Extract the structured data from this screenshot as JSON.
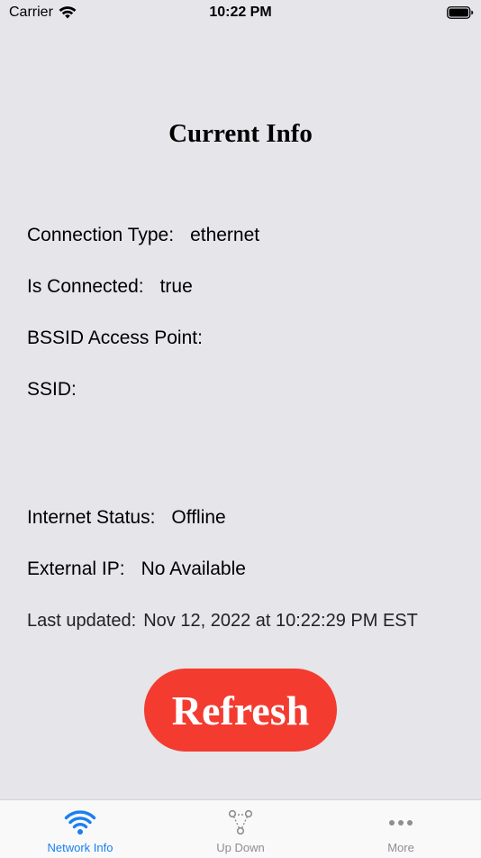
{
  "status_bar": {
    "carrier": "Carrier",
    "time": "10:22 PM"
  },
  "title": "Current Info",
  "info": {
    "connection_type_label": "Connection Type:",
    "connection_type_value": "ethernet",
    "is_connected_label": "Is Connected:",
    "is_connected_value": "true",
    "bssid_label": "BSSID Access Point:",
    "bssid_value": "",
    "ssid_label": "SSID:",
    "ssid_value": "",
    "internet_status_label": "Internet Status:",
    "internet_status_value": "Offline",
    "external_ip_label": "External IP:",
    "external_ip_value": "No Available",
    "last_updated_label": "Last updated:",
    "last_updated_value": "Nov 12, 2022 at 10:22:29 PM EST"
  },
  "refresh_button": {
    "label": "Refresh",
    "color": "#f33b30"
  },
  "tab_bar": {
    "tabs": [
      {
        "label": "Network Info",
        "icon": "wifi-icon",
        "active": true
      },
      {
        "label": "Up Down",
        "icon": "network-nodes-icon",
        "active": false
      },
      {
        "label": "More",
        "icon": "more-dots-icon",
        "active": false
      }
    ],
    "active_color": "#1a7ff0",
    "inactive_color": "#8e8e93"
  }
}
